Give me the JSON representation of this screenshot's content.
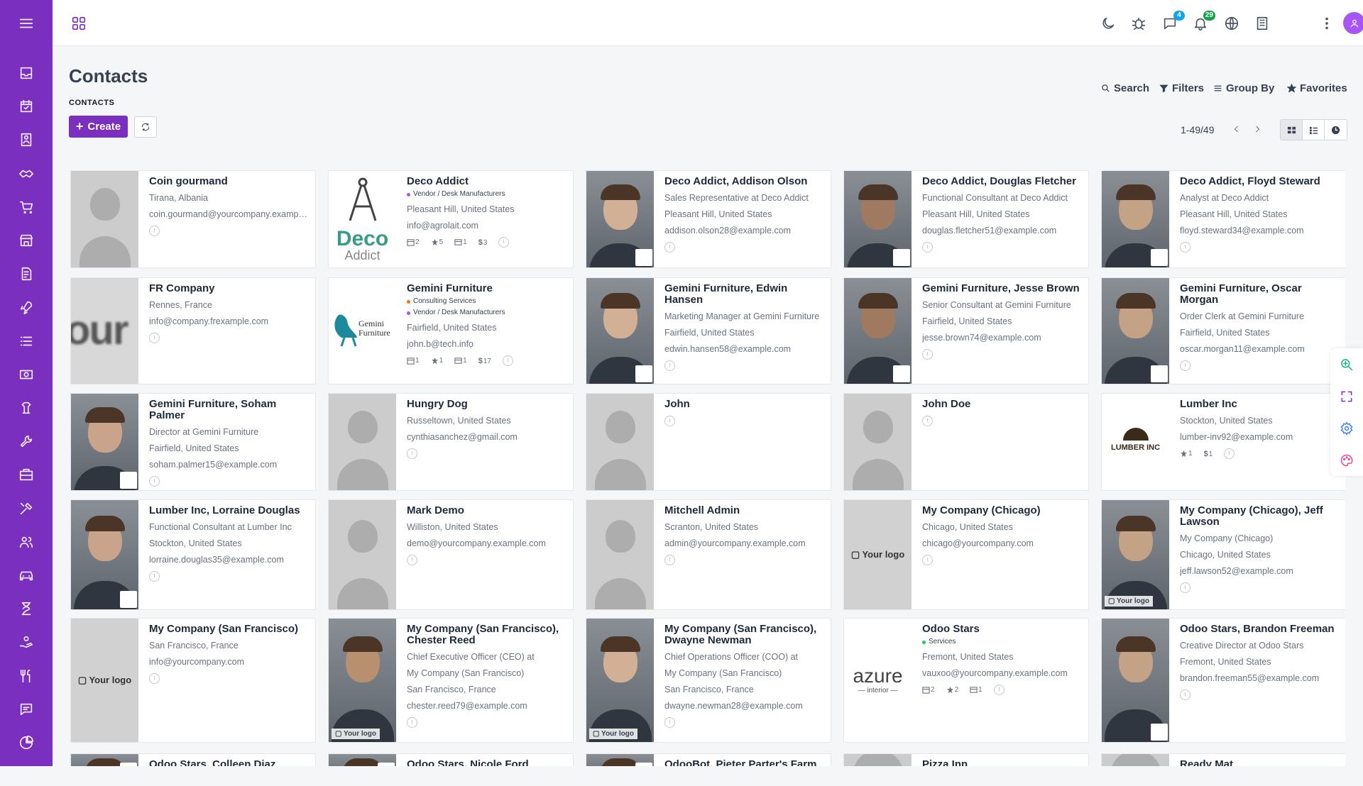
{
  "app": {
    "title": "Contacts",
    "breadcrumb": "CONTACTS",
    "create_label": "Create",
    "pager": "1-49/49",
    "accent_color": "#7b2fbe"
  },
  "topbar": {
    "chat_count": "4",
    "notification_count": "29"
  },
  "search": {
    "search_label": "Search",
    "filters_label": "Filters",
    "groupby_label": "Group By",
    "favorites_label": "Favorites"
  },
  "sidebar": {
    "icons": [
      "inbox-icon",
      "calendar-icon",
      "contacts-icon",
      "handshake-icon",
      "cart-icon",
      "store-icon",
      "invoice-icon",
      "rocket-icon",
      "list-icon",
      "money-icon",
      "document-icon",
      "wrench-icon",
      "briefcase-icon",
      "tools-icon",
      "users-icon",
      "car-icon",
      "hourglass-icon",
      "hand-coins-icon",
      "restaurant-icon",
      "chat-icon",
      "pie-chart-icon",
      "more-icon"
    ]
  },
  "contacts": [
    {
      "name": "Coin gourmand",
      "lines": [
        "Tirana, Albania",
        "coin.gourmand@yourcompany.example.com"
      ],
      "image": "placeholder"
    },
    {
      "name": "Deco Addict",
      "tags": [
        {
          "label": "Vendor / Desk Manufacturers",
          "color": "#a855f7"
        }
      ],
      "lines": [
        "Pleasant Hill, United States",
        "info@agrolait.com"
      ],
      "counters": [
        "2",
        "5",
        "1",
        "3"
      ],
      "image": "deco"
    },
    {
      "name": "Deco Addict, Addison Olson",
      "lines": [
        "Sales Representative at Deco Addict",
        "Pleasant Hill, United States",
        "addison.olson28@example.com"
      ],
      "image": "photo"
    },
    {
      "name": "Deco Addict, Douglas Fletcher",
      "lines": [
        "Functional Consultant at Deco Addict",
        "Pleasant Hill, United States",
        "douglas.fletcher51@example.com"
      ],
      "image": "photo"
    },
    {
      "name": "Deco Addict, Floyd Steward",
      "lines": [
        "Analyst at Deco Addict",
        "Pleasant Hill, United States",
        "floyd.steward34@example.com"
      ],
      "image": "photo"
    },
    {
      "name": "FR Company",
      "lines": [
        "Rennes, France",
        "info@company.frexample.com"
      ],
      "image": "blurlogo"
    },
    {
      "name": "Gemini Furniture",
      "tags": [
        {
          "label": "Consulting Services",
          "color": "#f97316"
        },
        {
          "label": "Vendor / Desk Manufacturers",
          "color": "#a855f7"
        }
      ],
      "lines": [
        "Fairfield, United States",
        "john.b@tech.info"
      ],
      "counters": [
        "1",
        "1",
        "1",
        "17"
      ],
      "image": "gemini"
    },
    {
      "name": "Gemini Furniture, Edwin Hansen",
      "lines": [
        "Marketing Manager at Gemini Furniture",
        "Fairfield, United States",
        "edwin.hansen58@example.com"
      ],
      "image": "photo"
    },
    {
      "name": "Gemini Furniture, Jesse Brown",
      "lines": [
        "Senior Consultant at Gemini Furniture",
        "Fairfield, United States",
        "jesse.brown74@example.com"
      ],
      "image": "photo"
    },
    {
      "name": "Gemini Furniture, Oscar Morgan",
      "lines": [
        "Order Clerk at Gemini Furniture",
        "Fairfield, United States",
        "oscar.morgan11@example.com"
      ],
      "image": "photo"
    },
    {
      "name": "Gemini Furniture, Soham Palmer",
      "lines": [
        "Director at Gemini Furniture",
        "Fairfield, United States",
        "soham.palmer15@example.com"
      ],
      "image": "photo"
    },
    {
      "name": "Hungry Dog",
      "lines": [
        "Russeltown, United States",
        "cynthiasanchez@gmail.com"
      ],
      "image": "placeholder"
    },
    {
      "name": "John",
      "lines": [],
      "image": "placeholder"
    },
    {
      "name": "John Doe",
      "lines": [],
      "image": "placeholder"
    },
    {
      "name": "Lumber Inc",
      "lines": [
        "Stockton, United States",
        "lumber-inv92@example.com"
      ],
      "counters2": [
        "1",
        "1"
      ],
      "image": "lumber"
    },
    {
      "name": "Lumber Inc, Lorraine Douglas",
      "lines": [
        "Functional Consultant at Lumber Inc",
        "Stockton, United States",
        "lorraine.douglas35@example.com"
      ],
      "image": "photo"
    },
    {
      "name": "Mark Demo",
      "lines": [
        "Williston, United States",
        "demo@yourcompany.example.com"
      ],
      "image": "placeholder"
    },
    {
      "name": "Mitchell Admin",
      "lines": [
        "Scranton, United States",
        "admin@yourcompany.example.com"
      ],
      "image": "placeholder"
    },
    {
      "name": "My Company (Chicago)",
      "lines": [
        "Chicago, United States",
        "chicago@yourcompany.com"
      ],
      "image": "yourlogo",
      "logo_text": "Your logo"
    },
    {
      "name": "My Company (Chicago), Jeff Lawson",
      "lines": [
        "My Company (Chicago)",
        "Chicago, United States",
        "jeff.lawson52@example.com"
      ],
      "image": "photo",
      "badge": "Your logo"
    },
    {
      "name": "My Company (San Francisco)",
      "lines": [
        "San Francisco, France",
        "info@yourcompany.com"
      ],
      "image": "yourlogo",
      "logo_text": "Your logo"
    },
    {
      "name": "My Company (San Francisco), Chester Reed",
      "lines": [
        "Chief Executive Officer (CEO) at",
        "My Company (San Francisco)",
        "San Francisco, France",
        "chester.reed79@example.com"
      ],
      "image": "photo",
      "badge": "Your logo"
    },
    {
      "name": "My Company (San Francisco), Dwayne Newman",
      "lines": [
        "Chief Operations Officer (COO) at",
        "My Company (San Francisco)",
        "San Francisco, France",
        "dwayne.newman28@example.com"
      ],
      "image": "photo",
      "badge": "Your logo"
    },
    {
      "name": "Odoo Stars",
      "tags": [
        {
          "label": "Services",
          "color": "#22c55e"
        }
      ],
      "lines": [
        "Fremont, United States",
        "vauxoo@yourcompany.example.com"
      ],
      "counters3": [
        "2",
        "2",
        "1"
      ],
      "image": "azure"
    },
    {
      "name": "Odoo Stars, Brandon Freeman",
      "lines": [
        "Creative Director at Odoo Stars",
        "Fremont, United States",
        "brandon.freeman55@example.com"
      ],
      "image": "photo"
    },
    {
      "name": "Odoo Stars, Colleen Diaz",
      "lines": [],
      "image": "photo"
    },
    {
      "name": "Odoo Stars, Nicole Ford",
      "lines": [],
      "image": "photo"
    },
    {
      "name": "OdooBot, Pieter Parter's Farm",
      "lines": [],
      "image": "photo"
    },
    {
      "name": "Pizza Inn",
      "lines": [],
      "image": "placeholder"
    },
    {
      "name": "Ready Mat",
      "lines": [],
      "image": "placeholder"
    }
  ],
  "logos": {
    "deco_line1": "Deco",
    "deco_line2": "Addict",
    "gemini_line1": "Gemini",
    "gemini_line2": "Furniture",
    "lumber": "LUMBER INC",
    "azure_line1": "azure",
    "azure_line2": "interior",
    "fr_blur": "our"
  }
}
